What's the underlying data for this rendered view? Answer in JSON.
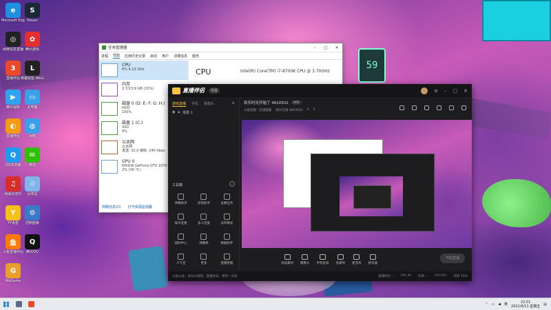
{
  "desktop_icons": [
    {
      "label": "Microsoft Edge",
      "color": "#1f8fe0",
      "glyph": "e"
    },
    {
      "label": "Steam",
      "color": "#1b2838",
      "glyph": "S"
    },
    {
      "label": "网络信息直播",
      "color": "#222",
      "glyph": "◎"
    },
    {
      "label": "腾讯游戏",
      "color": "#e23030",
      "glyph": "✿"
    },
    {
      "label": "直播伴侣",
      "color": "#e84a2a",
      "glyph": "3"
    },
    {
      "label": "英雄联盟 WeGame版",
      "color": "#222",
      "glyph": "L"
    },
    {
      "label": "腾讯视频",
      "color": "#2fa3f0",
      "glyph": "▶"
    },
    {
      "label": "此电脑",
      "color": "#3aa0e8",
      "glyph": "▭"
    },
    {
      "label": "直播伴侣",
      "color": "#f39c12",
      "glyph": "◐"
    },
    {
      "label": "网络",
      "color": "#3aa0e8",
      "glyph": "◍"
    },
    {
      "label": "QQ浏览器",
      "color": "#1d9bf0",
      "glyph": "Q"
    },
    {
      "label": "微信",
      "color": "#2dc100",
      "glyph": "✉"
    },
    {
      "label": "网易云音乐",
      "color": "#d62c2c",
      "glyph": "♫"
    },
    {
      "label": "回收站",
      "color": "#7fb5e8",
      "glyph": "♲"
    },
    {
      "label": "YY语音",
      "color": "#f4c01a",
      "glyph": "Y"
    },
    {
      "label": "控制面板",
      "color": "#3a7ac8",
      "glyph": "⚙"
    },
    {
      "label": "斗鱼直播伴侣",
      "color": "#ff7a00",
      "glyph": "鱼"
    },
    {
      "label": "腾讯QQ",
      "color": "#111",
      "glyph": "Q"
    },
    {
      "label": "WeGame",
      "color": "#e8a02a",
      "glyph": "G"
    }
  ],
  "task_manager": {
    "title": "任务管理器",
    "tabs": [
      "进程",
      "性能",
      "应用历史记录",
      "启动",
      "用户",
      "详细信息",
      "服务"
    ],
    "active_tab": "性能",
    "items": [
      {
        "name": "CPU",
        "detail": "6% 4.15 GHz",
        "color": "#6a9fd4"
      },
      {
        "name": "内存",
        "detail": "3.7/23.9 GB (15%)",
        "color": "#9a4ab0"
      },
      {
        "name": "磁盘 0 (D: E: F: G: H:)",
        "detail": "HDD\n100%",
        "color": "#4a9a3a"
      },
      {
        "name": "磁盘 1 (C:)",
        "detail": "SSD\n0%",
        "color": "#4a9a3a"
      },
      {
        "name": "以太网",
        "detail": "以太网\n发送: 32.0 接收: 240 Kbps",
        "color": "#a8642a"
      },
      {
        "name": "GPU 0",
        "detail": "NVIDIA GeForce GTX 1070\n2% (39 °C)",
        "color": "#6a9fd4"
      }
    ],
    "main_title": "CPU",
    "cpu_name": "Intel(R) Core(TM) i7-8700K CPU @ 3.70GHz",
    "footer_left": "简略信息(D)",
    "footer_right": "打开资源监视器"
  },
  "streamer": {
    "app_name": "直播伴侣",
    "badge": "抖音",
    "left_tabs": [
      "游戏直播",
      "手机",
      "摄像头"
    ],
    "scene_label": "场景 1",
    "tools_title": "工具箱",
    "tools": [
      "弹幕助手",
      "房管助手",
      "主播任务",
      "观众连麦",
      "多人连麦",
      "派单模式",
      "福利中心",
      "弹幕秀",
      "数据助手",
      "人气宝",
      "更多",
      "直播管理"
    ],
    "header_title": "欢乐时光开始了 4810502",
    "header_tag": "修改",
    "header_meta": [
      "斗鱼无限 · 在线观看",
      "观众在线 4810502",
      "0",
      "0"
    ],
    "bottom_buttons": [
      "添加素材",
      "摄像头",
      "手机投屏",
      "多媒体",
      "麦克风",
      "扬声器"
    ],
    "golive": "开始直播",
    "status_left": "斗鱼公会，协议与规则，直播协议，更新一览表",
    "status_right": [
      "直播时长 --",
      "FPS 30",
      "码率 --",
      "CPU 6%",
      "内存 15%"
    ]
  },
  "taskbar": {
    "time": "22:51",
    "date": "2021/6/11 星期五",
    "lang": "英"
  }
}
